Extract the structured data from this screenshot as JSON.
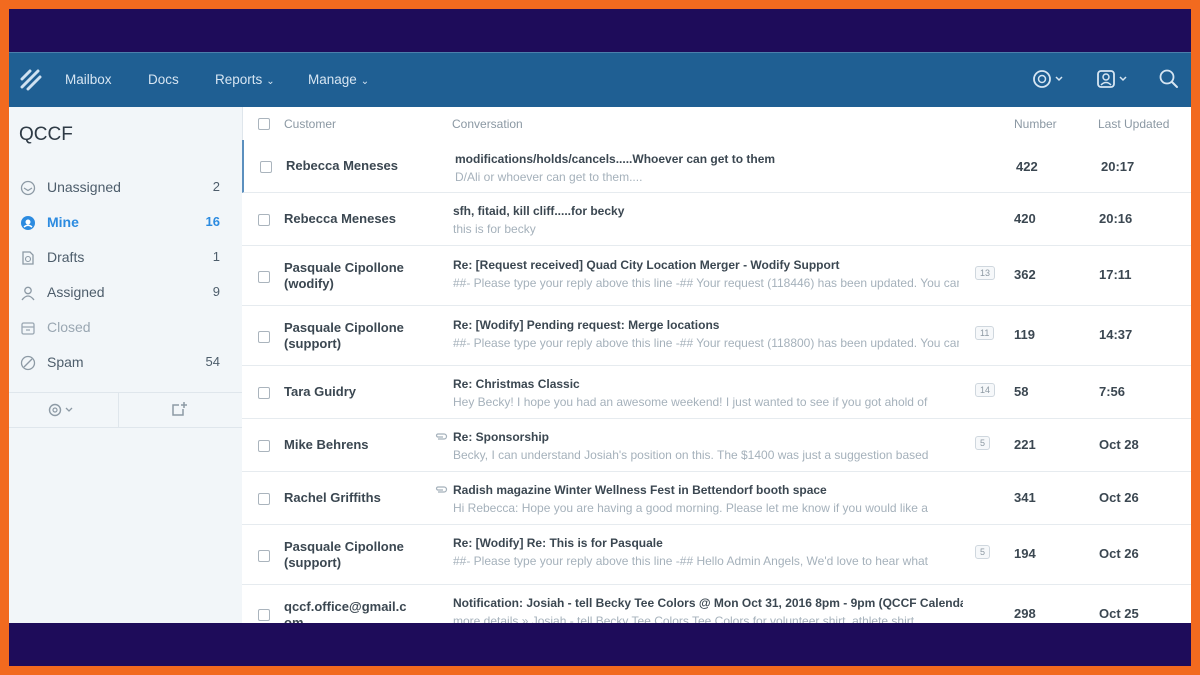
{
  "nav": {
    "items": [
      {
        "label": "Mailbox",
        "caret": ""
      },
      {
        "label": "Docs",
        "caret": ""
      },
      {
        "label": "Reports",
        "caret": "⌄"
      },
      {
        "label": "Manage",
        "caret": "⌄"
      }
    ],
    "right_icons": [
      "help-icon",
      "user-profile-icon",
      "search-icon"
    ]
  },
  "sidebar": {
    "title": "QCCF",
    "folders": [
      {
        "label": "Unassigned",
        "count": "2",
        "icon": "inbox-icon"
      },
      {
        "label": "Mine",
        "count": "16",
        "icon": "mine-icon"
      },
      {
        "label": "Drafts",
        "count": "1",
        "icon": "drafts-icon"
      },
      {
        "label": "Assigned",
        "count": "9",
        "icon": "person-icon"
      },
      {
        "label": "Closed",
        "count": "",
        "icon": "archive-icon"
      },
      {
        "label": "Spam",
        "count": "54",
        "icon": "spam-icon"
      }
    ],
    "tools": [
      "settings-icon",
      "new-conversation-icon"
    ]
  },
  "table": {
    "headers": {
      "customer": "Customer",
      "conversation": "Conversation",
      "number": "Number",
      "updated": "Last Updated"
    },
    "rows": [
      {
        "customer": "Rebecca Meneses",
        "subject": "modifications/holds/cancels.....Whoever can get to them",
        "preview": "D/Ali or whoever can get to them....",
        "count": "",
        "number": "422",
        "updated": "20:17"
      },
      {
        "customer": "Rebecca Meneses",
        "subject": "sfh, fitaid, kill cliff.....for becky",
        "preview": "this is for becky",
        "count": "",
        "number": "420",
        "updated": "20:16"
      },
      {
        "customer": "Pasquale Cipollone (wodify)",
        "subject": "Re: [Request received] Quad City Location Merger - Wodify Support",
        "preview": "##- Please type your reply above this line -## Your request (118446) has been updated. You can add",
        "count": "13",
        "number": "362",
        "updated": "17:11"
      },
      {
        "customer": "Pasquale Cipollone (support)",
        "subject": "Re: [Wodify] Pending request: Merge locations",
        "preview": "##- Please type your reply above this line -## Your request (118800) has been updated. You can add",
        "count": "11",
        "number": "119",
        "updated": "14:37"
      },
      {
        "customer": "Tara Guidry",
        "subject": "Re: Christmas Classic",
        "preview": "Hey Becky! I hope you had an awesome weekend! I just wanted to see if you got ahold of",
        "count": "14",
        "number": "58",
        "updated": "7:56"
      },
      {
        "customer": "Mike Behrens",
        "subject": "Re: Sponsorship",
        "preview": "Becky, I can understand Josiah's position on this. The $1400 was just a suggestion based",
        "count": "5",
        "number": "221",
        "updated": "Oct 28"
      },
      {
        "customer": "Rachel Griffiths",
        "subject": "Radish magazine Winter Wellness Fest in Bettendorf booth space",
        "preview": "Hi Rebecca: Hope you are having a good morning. Please let me know if you would like a",
        "count": "",
        "number": "341",
        "updated": "Oct 26"
      },
      {
        "customer": "Pasquale Cipollone (support)",
        "subject": "Re: [Wodify] Re: This is for Pasquale",
        "preview": "##- Please type your reply above this line -## Hello Admin Angels, We'd love to hear what",
        "count": "5",
        "number": "194",
        "updated": "Oct 26"
      },
      {
        "customer": "qccf.office@gmail.com",
        "subject": "Notification: Josiah - tell Becky Tee Colors @ Mon Oct 31, 2016 8pm - 9pm (QCCF Calendar)",
        "preview": "more details » Josiah - tell Becky Tee Colors Tee Colors for volunteer shirt, athlete shirt",
        "count": "",
        "number": "298",
        "updated": "Oct 25"
      }
    ]
  },
  "colors": {
    "navbar": "#1f5f93",
    "accent": "#2c8be0",
    "frame": "#1e0c5a",
    "border": "#f26a1f"
  }
}
